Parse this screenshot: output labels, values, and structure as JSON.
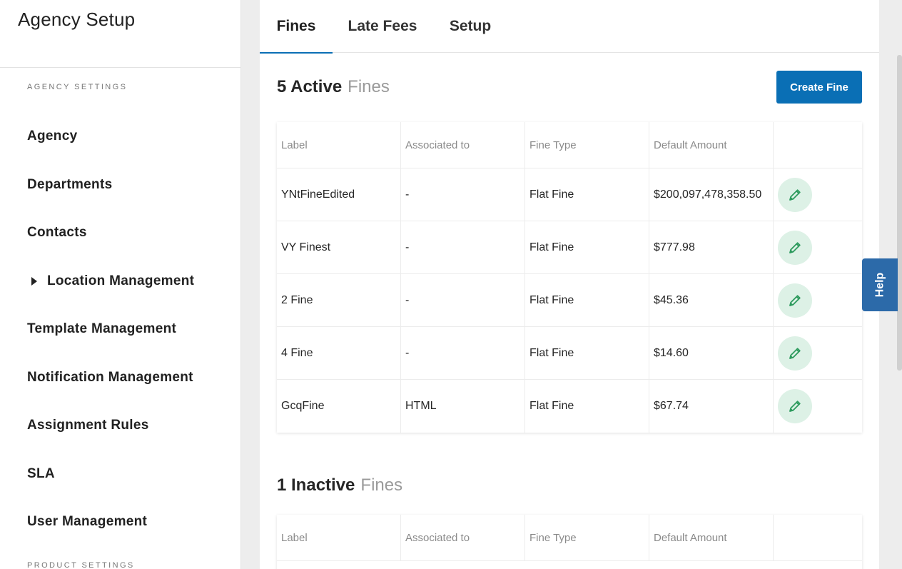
{
  "sidebar": {
    "title": "Agency Setup",
    "sections": [
      {
        "heading": "AGENCY SETTINGS"
      },
      {
        "heading": "PRODUCT SETTINGS"
      }
    ],
    "items": [
      {
        "label": "Agency"
      },
      {
        "label": "Departments"
      },
      {
        "label": "Contacts"
      },
      {
        "label": "Location Management",
        "expandable": true
      },
      {
        "label": "Template Management"
      },
      {
        "label": "Notification Management"
      },
      {
        "label": "Assignment Rules"
      },
      {
        "label": "SLA"
      },
      {
        "label": "User Management"
      }
    ]
  },
  "tabs": [
    {
      "label": "Fines",
      "active": true
    },
    {
      "label": "Late Fees"
    },
    {
      "label": "Setup"
    }
  ],
  "active_section": {
    "count_label": "5 Active",
    "suffix": "Fines",
    "create_button": "Create Fine"
  },
  "inactive_section": {
    "count_label": "1 Inactive",
    "suffix": "Fines"
  },
  "table_headers": [
    "Label",
    "Associated to",
    "Fine Type",
    "Default Amount"
  ],
  "active_rows": [
    {
      "label": "YNtFineEdited",
      "associated": "-",
      "type": "Flat Fine",
      "amount": "$200,097,478,358.50"
    },
    {
      "label": "VY Finest",
      "associated": "-",
      "type": "Flat Fine",
      "amount": "$777.98"
    },
    {
      "label": "2 Fine",
      "associated": "-",
      "type": "Flat Fine",
      "amount": "$45.36"
    },
    {
      "label": "4 Fine",
      "associated": "-",
      "type": "Flat Fine",
      "amount": "$14.60"
    },
    {
      "label": "GcqFine",
      "associated": "HTML",
      "type": "Flat Fine",
      "amount": "$67.74"
    }
  ],
  "help_label": "Help",
  "icons": {
    "edit": "pencil-icon",
    "expand": "caret-right-icon"
  },
  "colors": {
    "primary": "#0a6fb5",
    "edit_bg": "#ddf1e6",
    "edit_icon": "#2e9b5e",
    "help_bg": "#2c6aa9"
  }
}
